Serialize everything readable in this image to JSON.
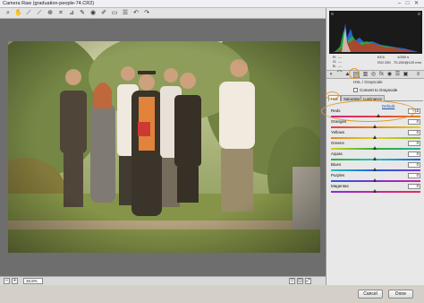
{
  "window": {
    "title": "Camera Raw (graduation-people-74.CR2)",
    "controls": [
      "–",
      "□",
      "✕"
    ]
  },
  "toolbar": {
    "tools": [
      "zoom-icon",
      "hand-icon",
      "white-balance-icon",
      "color-sampler-icon",
      "target-adjust-icon",
      "crop-icon",
      "straighten-icon",
      "spot-removal-icon",
      "red-eye-icon",
      "adjustment-brush-icon",
      "graduated-filter-icon",
      "preferences-icon",
      "rotate-ccw-icon",
      "rotate-cw-icon"
    ]
  },
  "status": {
    "zoom": "26.8%",
    "zoom_minus": "–",
    "zoom_plus": "+"
  },
  "readout": {
    "r_label": "R:",
    "g_label": "G:",
    "b_label": "B:",
    "r_value": "---",
    "g_value": "---",
    "b_value": "---",
    "aperture": "f/3.5",
    "shutter": "1/250 s",
    "iso": "ISO 250",
    "lens": "70-200@120 mm"
  },
  "panel": {
    "section_title": "HSL / Grayscale",
    "convert_label": "Convert to Grayscale",
    "tabs": [
      "Hue",
      "Saturation",
      "Luminance"
    ],
    "active_tab": "Hue",
    "default_link": "Default",
    "sliders": [
      {
        "label": "Reds",
        "value": "+15",
        "position": 0.54,
        "gradient": "linear-gradient(90deg,#d0208c,#e04040,#e08020)"
      },
      {
        "label": "Oranges",
        "value": "0",
        "position": 0.5,
        "gradient": "linear-gradient(90deg,#e04040,#e08a20,#e0d020)"
      },
      {
        "label": "Yellows",
        "value": "0",
        "position": 0.5,
        "gradient": "linear-gradient(90deg,#e08a20,#e0d020,#80c020)"
      },
      {
        "label": "Greens",
        "value": "0",
        "position": 0.5,
        "gradient": "linear-gradient(90deg,#d0d020,#30b030,#20b0a0)"
      },
      {
        "label": "Aquas",
        "value": "0",
        "position": 0.5,
        "gradient": "linear-gradient(90deg,#30b030,#20c0c0,#2060e0)"
      },
      {
        "label": "Blues",
        "value": "0",
        "position": 0.5,
        "gradient": "linear-gradient(90deg,#20c0c0,#2060e0,#8030d0)"
      },
      {
        "label": "Purples",
        "value": "0",
        "position": 0.5,
        "gradient": "linear-gradient(90deg,#2060e0,#8030d0,#d020a0)"
      },
      {
        "label": "Magentas",
        "value": "0",
        "position": 0.5,
        "gradient": "linear-gradient(90deg,#8030d0,#d020a0,#e03050)"
      }
    ]
  },
  "buttons": {
    "cancel": "Cancel",
    "done": "Done"
  },
  "colors": {
    "highlight": "#e39a2d"
  }
}
